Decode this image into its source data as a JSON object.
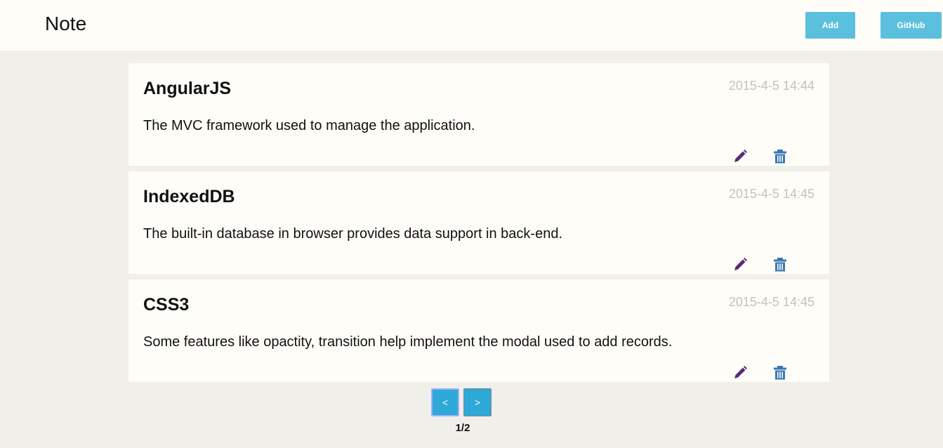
{
  "header": {
    "title": "Note",
    "add_label": "Add",
    "github_label": "GitHub"
  },
  "notes": [
    {
      "title": "AngularJS",
      "time": "2015-4-5 14:44",
      "content": "The MVC framework used to manage the application."
    },
    {
      "title": "IndexedDB",
      "time": "2015-4-5 14:45",
      "content": "The built-in database in browser provides data support in back-end."
    },
    {
      "title": "CSS3",
      "time": "2015-4-5 14:45",
      "content": "Some features like opactity, transition help implement the modal used to add records."
    }
  ],
  "icons": {
    "edit": "pencil-icon",
    "delete": "trash-icon"
  },
  "colors": {
    "header_bg": "#fffdf7",
    "page_bg": "#f1efea",
    "button": "#5bc0de",
    "pager_button": "#2ea8d6",
    "edit_icon": "#5a2a7a",
    "delete_icon": "#3a78b5",
    "timestamp": "#c5c2b8"
  },
  "pagination": {
    "prev_label": "<",
    "next_label": ">",
    "indicator": "1/2"
  }
}
